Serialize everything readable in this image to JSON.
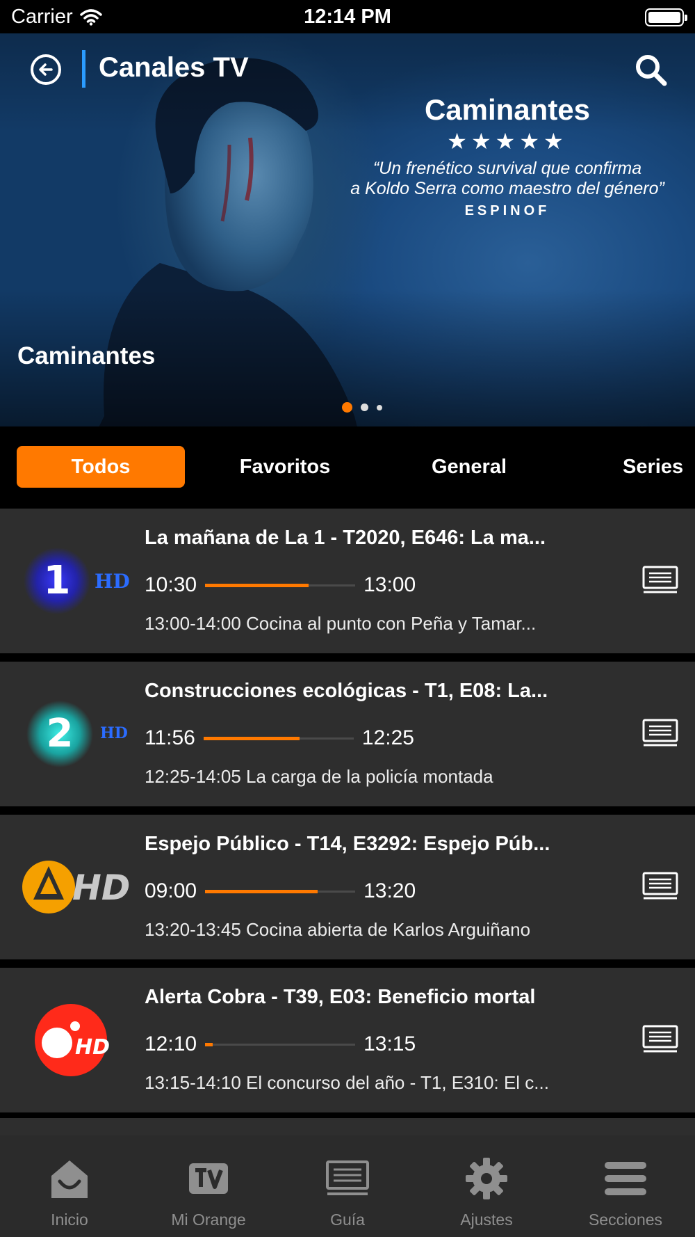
{
  "status_bar": {
    "carrier": "Carrier",
    "time": "12:14 PM"
  },
  "header": {
    "title": "Canales TV",
    "back_icon": "back-arrow-icon",
    "search_icon": "search-icon"
  },
  "hero": {
    "promo_title": "Caminantes",
    "promo_stars": "★★★★★",
    "promo_quote_line1": "“Un frenético survival que confirma",
    "promo_quote_line2": "a Koldo Serra como maestro del género”",
    "promo_source": "ESPINOF",
    "caption": "Caminantes",
    "carousel": {
      "count": 3,
      "active": 0
    }
  },
  "tabs": [
    {
      "label": "Todos",
      "active": true
    },
    {
      "label": "Favoritos",
      "active": false
    },
    {
      "label": "General",
      "active": false
    },
    {
      "label": "Series",
      "active": false
    }
  ],
  "channels": [
    {
      "logo": "la1-hd-logo-icon",
      "logo_text": "1",
      "logo_badge": "HD",
      "title": "La mañana de La 1 - T2020, E646: La ma...",
      "start": "10:30",
      "end": "13:00",
      "progress": 0.69,
      "next": "13:00-14:00 Cocina al punto con Peña y Tamar..."
    },
    {
      "logo": "la2-hd-logo-icon",
      "logo_text": "2",
      "logo_badge": "HD",
      "title": "Construcciones ecológicas - T1, E08: La...",
      "start": "11:56",
      "end": "12:25",
      "progress": 0.64,
      "next": "12:25-14:05 La carga de la policía montada"
    },
    {
      "logo": "antena3-hd-logo-icon",
      "logo_text": "",
      "logo_badge": "HD",
      "title": "Espejo Público - T14, E3292: Espejo Púb...",
      "start": "09:00",
      "end": "13:20",
      "progress": 0.75,
      "next": "13:20-13:45 Cocina abierta de Karlos Arguiñano"
    },
    {
      "logo": "cuatro-hd-logo-icon",
      "logo_text": "",
      "logo_badge": "HD",
      "title": "Alerta Cobra - T39, E03: Beneficio mortal",
      "start": "12:10",
      "end": "13:15",
      "progress": 0.05,
      "next": "13:15-14:10 El concurso del año - T1, E310: El c..."
    }
  ],
  "bottom_nav": [
    {
      "label": "Inicio",
      "icon": "home-icon"
    },
    {
      "label": "Mi Orange",
      "icon": "tv-badge-icon"
    },
    {
      "label": "Guía",
      "icon": "tv-guide-icon"
    },
    {
      "label": "Ajustes",
      "icon": "gear-icon"
    },
    {
      "label": "Secciones",
      "icon": "menu-icon"
    }
  ],
  "colors": {
    "accent": "#ff7900",
    "row_bg": "#2e2e2e",
    "nav_bg": "#2b2b2b",
    "header_divider": "#2b9cff"
  }
}
